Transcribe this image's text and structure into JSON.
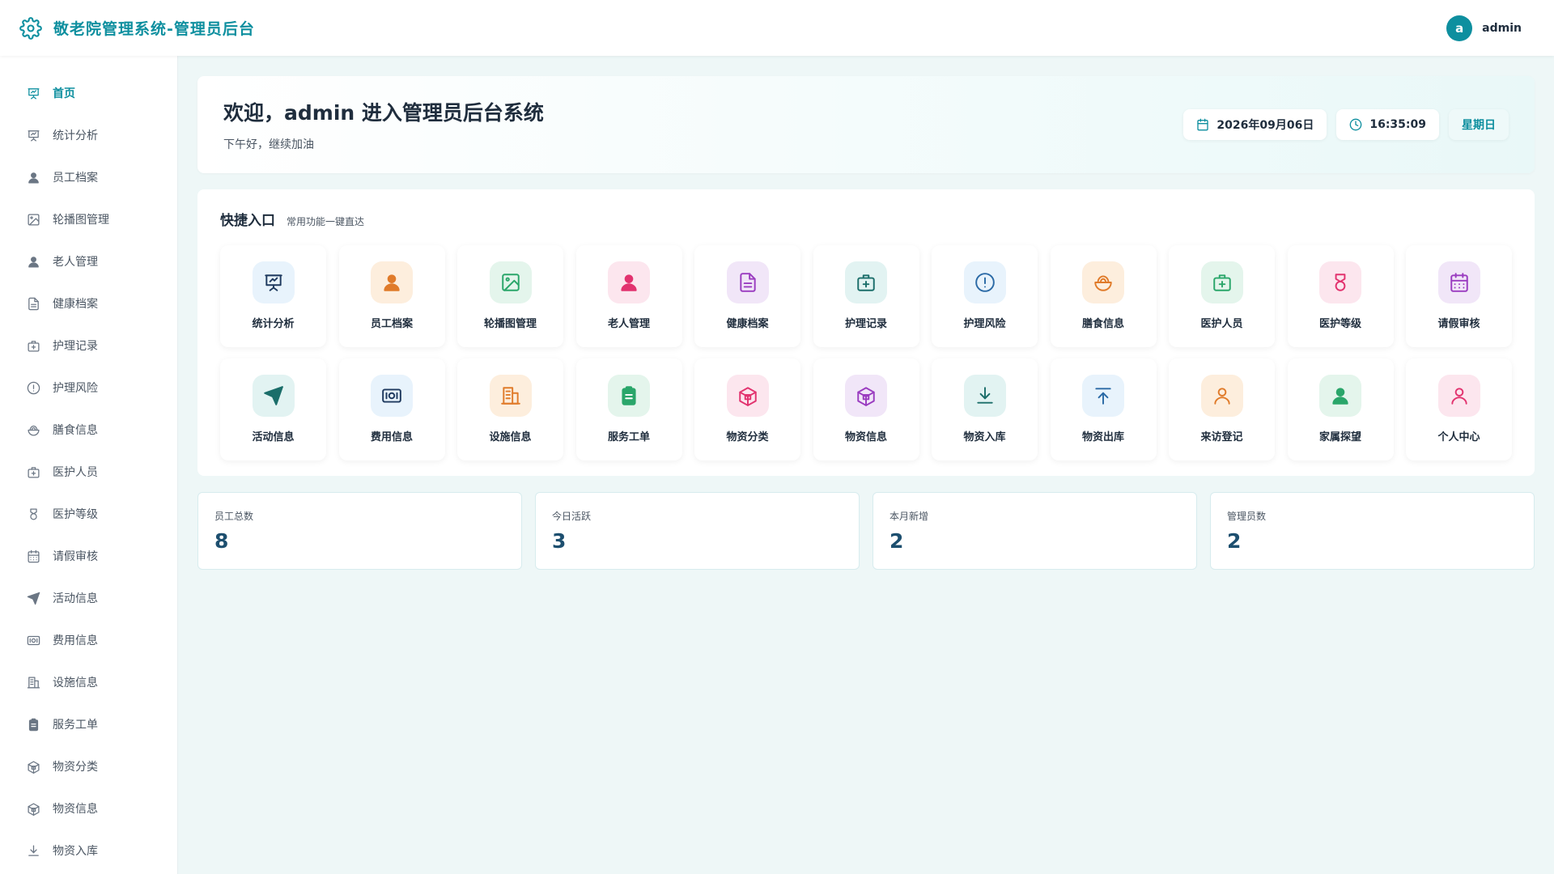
{
  "header": {
    "title": "敬老院管理系统-管理员后台",
    "brand_icon": "gear-icon",
    "avatar_letter": "a",
    "username": "admin"
  },
  "sidebar": {
    "items": [
      {
        "label": "首页",
        "icon": "presentation-icon",
        "active": true
      },
      {
        "label": "统计分析",
        "icon": "presentation-icon"
      },
      {
        "label": "员工档案",
        "icon": "user-icon"
      },
      {
        "label": "轮播图管理",
        "icon": "image-icon"
      },
      {
        "label": "老人管理",
        "icon": "user-icon"
      },
      {
        "label": "健康档案",
        "icon": "document-icon"
      },
      {
        "label": "护理记录",
        "icon": "medical-bag-icon"
      },
      {
        "label": "护理风险",
        "icon": "alert-circle-icon"
      },
      {
        "label": "膳食信息",
        "icon": "bowl-icon"
      },
      {
        "label": "医护人员",
        "icon": "medical-bag-icon"
      },
      {
        "label": "医护等级",
        "icon": "medal-icon"
      },
      {
        "label": "请假审核",
        "icon": "calendar-icon"
      },
      {
        "label": "活动信息",
        "icon": "send-icon"
      },
      {
        "label": "费用信息",
        "icon": "money-icon"
      },
      {
        "label": "设施信息",
        "icon": "building-icon"
      },
      {
        "label": "服务工单",
        "icon": "clipboard-icon"
      },
      {
        "label": "物资分类",
        "icon": "package-icon"
      },
      {
        "label": "物资信息",
        "icon": "package-icon"
      },
      {
        "label": "物资入库",
        "icon": "download-icon"
      }
    ]
  },
  "welcome": {
    "title": "欢迎，admin 进入管理员后台系统",
    "subtitle": "下午好，继续加油",
    "date": "2026年09月06日",
    "time": "16:35:09",
    "weekday": "星期日"
  },
  "quick": {
    "title": "快捷入口",
    "subtitle": "常用功能一键直达",
    "tiles": [
      {
        "label": "统计分析",
        "icon": "presentation-icon",
        "theme": "t-blue"
      },
      {
        "label": "员工档案",
        "icon": "user-icon",
        "theme": "t-orange"
      },
      {
        "label": "轮播图管理",
        "icon": "image-icon",
        "theme": "t-green"
      },
      {
        "label": "老人管理",
        "icon": "user-icon",
        "theme": "t-pink"
      },
      {
        "label": "健康档案",
        "icon": "document-icon",
        "theme": "t-purple"
      },
      {
        "label": "护理记录",
        "icon": "medical-bag-icon",
        "theme": "t-teal"
      },
      {
        "label": "护理风险",
        "icon": "alert-circle-icon",
        "theme": "t-lightblue"
      },
      {
        "label": "膳食信息",
        "icon": "bowl-icon",
        "theme": "t-orange"
      },
      {
        "label": "医护人员",
        "icon": "medical-bag-icon",
        "theme": "t-green"
      },
      {
        "label": "医护等级",
        "icon": "medal-icon",
        "theme": "t-pink"
      },
      {
        "label": "请假审核",
        "icon": "calendar-icon",
        "theme": "t-purple"
      },
      {
        "label": "活动信息",
        "icon": "send-icon",
        "theme": "t-teal"
      },
      {
        "label": "费用信息",
        "icon": "money-icon",
        "theme": "t-blue"
      },
      {
        "label": "设施信息",
        "icon": "building-icon",
        "theme": "t-orange"
      },
      {
        "label": "服务工单",
        "icon": "clipboard-icon",
        "theme": "t-green"
      },
      {
        "label": "物资分类",
        "icon": "package-icon",
        "theme": "t-pink"
      },
      {
        "label": "物资信息",
        "icon": "package-icon",
        "theme": "t-purple"
      },
      {
        "label": "物资入库",
        "icon": "download-icon",
        "theme": "t-teal"
      },
      {
        "label": "物资出库",
        "icon": "upload-icon",
        "theme": "t-lightblue"
      },
      {
        "label": "来访登记",
        "icon": "user-outline-icon",
        "theme": "t-orange"
      },
      {
        "label": "家属探望",
        "icon": "user-icon",
        "theme": "t-green"
      },
      {
        "label": "个人中心",
        "icon": "user-outline-icon",
        "theme": "t-pink"
      }
    ]
  },
  "stats": [
    {
      "label": "员工总数",
      "value": "8"
    },
    {
      "label": "今日活跃",
      "value": "3"
    },
    {
      "label": "本月新增",
      "value": "2"
    },
    {
      "label": "管理员数",
      "value": "2"
    }
  ],
  "colors": {
    "brand": "#0e8f9f",
    "stat_value": "#1d4f6f"
  }
}
